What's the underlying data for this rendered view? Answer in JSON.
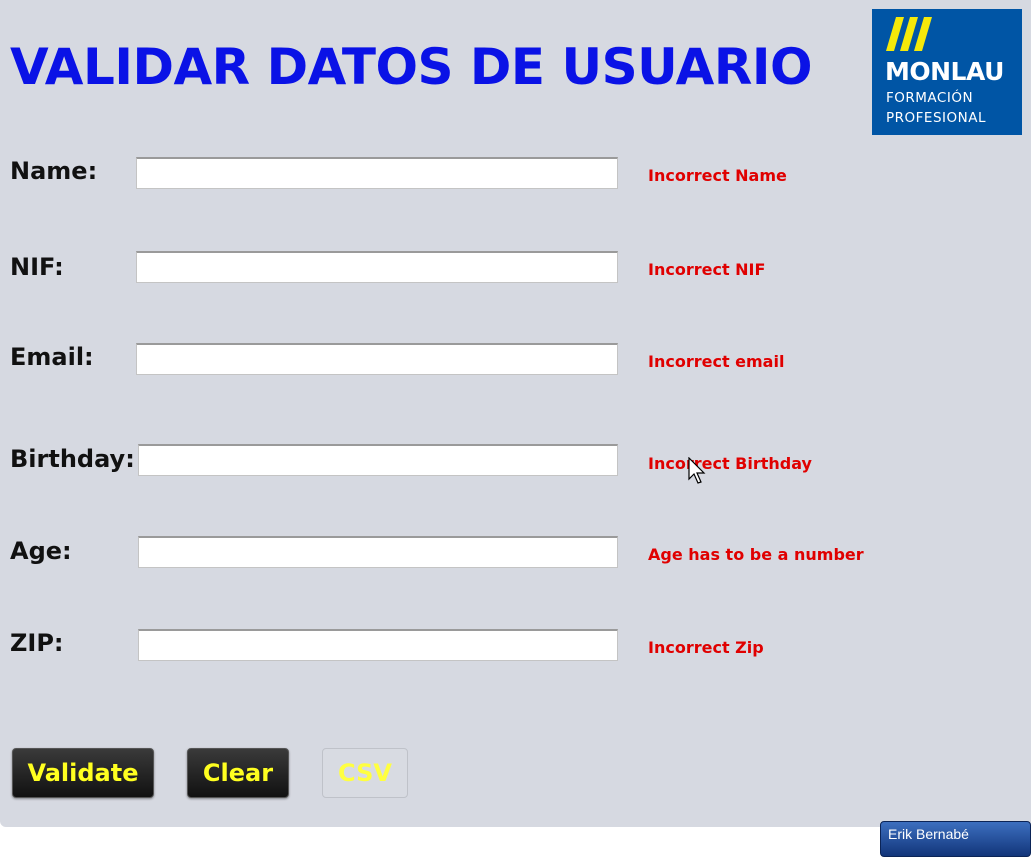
{
  "header": {
    "title": "VALIDAR DATOS DE USUARIO"
  },
  "logo": {
    "brand": "MONLAU",
    "line1": "FORMACIÓN",
    "line2": "PROFESIONAL",
    "colors": {
      "background": "#0055a5",
      "stripes": "#f5e90a"
    }
  },
  "form": {
    "name": {
      "label": "Name:",
      "value": "",
      "error": "Incorrect Name"
    },
    "nif": {
      "label": "NIF:",
      "value": "",
      "error": "Incorrect NIF"
    },
    "email": {
      "label": "Email:",
      "value": "",
      "error": "Incorrect email"
    },
    "birthday": {
      "label": "Birthday:",
      "value": "",
      "error": "Incorrect Birthday"
    },
    "age": {
      "label": "Age:",
      "value": "",
      "error": "Age has to be a number"
    },
    "zip": {
      "label": "ZIP:",
      "value": "",
      "error": "Incorrect Zip"
    }
  },
  "buttons": {
    "validate": "Validate",
    "clear": "Clear",
    "csv": "CSV",
    "csv_enabled": false
  },
  "taskbar": {
    "user": "Erik Bernabé"
  },
  "colors": {
    "background": "#d6d9e1",
    "title": "#0a12e6",
    "error": "#e00000",
    "button_text": "#ffff20"
  }
}
